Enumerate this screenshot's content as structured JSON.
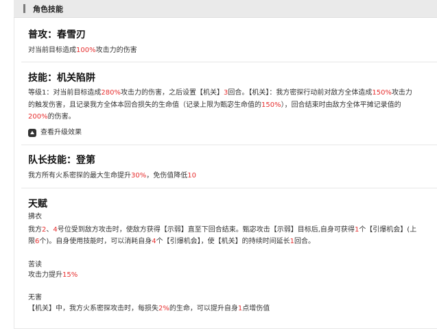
{
  "header": {
    "title": "角色技能"
  },
  "normal_attack": {
    "title": "普攻：春雪刃",
    "desc": [
      "对当前目标造成",
      "100%",
      "攻击力的伤害"
    ]
  },
  "skill": {
    "title": "技能：机关陷阱",
    "line1": [
      "等级1：对当前目标造成",
      "280%",
      "攻击力的伤害，之后设置【机关】",
      "3",
      "回合。【机关】：我方密探行动前对敌方全体造成",
      "150%",
      "攻击力"
    ],
    "line2": [
      "的触发伤害，且记录我方全体本回合损失的生命值（记录上限为甄宓生命值的",
      "150%",
      "），回合结束时由敌方全体平摊记录值的"
    ],
    "line3": [
      "200%",
      "的伤害。"
    ],
    "upgrade_label": "查看升级效果"
  },
  "leader_skill": {
    "title": "队长技能：登第",
    "desc": [
      "我方所有火系密探的最大生命提升",
      "30%",
      "，免伤值降低",
      "10"
    ]
  },
  "talent": {
    "title": "天赋",
    "t1_name": "拂衣",
    "t1_line1": [
      "我方",
      "2",
      "、",
      "4",
      "号位受到敌方攻击时，使敌方获得【示弱】直至下回合结束。甄宓攻击【示弱】目标后,自身可获得",
      "1",
      "个【引爆机会】(上"
    ],
    "t1_line2": [
      "限",
      "6",
      "个)。自身使用技能时，可以消耗自身",
      "4",
      "个【引爆机会】，使【机关】的持续时间延长",
      "1",
      "回合。"
    ],
    "t2_name": "苦读",
    "t2_desc": [
      "攻击力提升",
      "15%"
    ],
    "t3_name": "无害",
    "t3_desc": [
      "【机关】中，我方火系密探攻击时，每损失",
      "2%",
      "的生命，可以提升自身",
      "1",
      "点增伤值"
    ]
  }
}
